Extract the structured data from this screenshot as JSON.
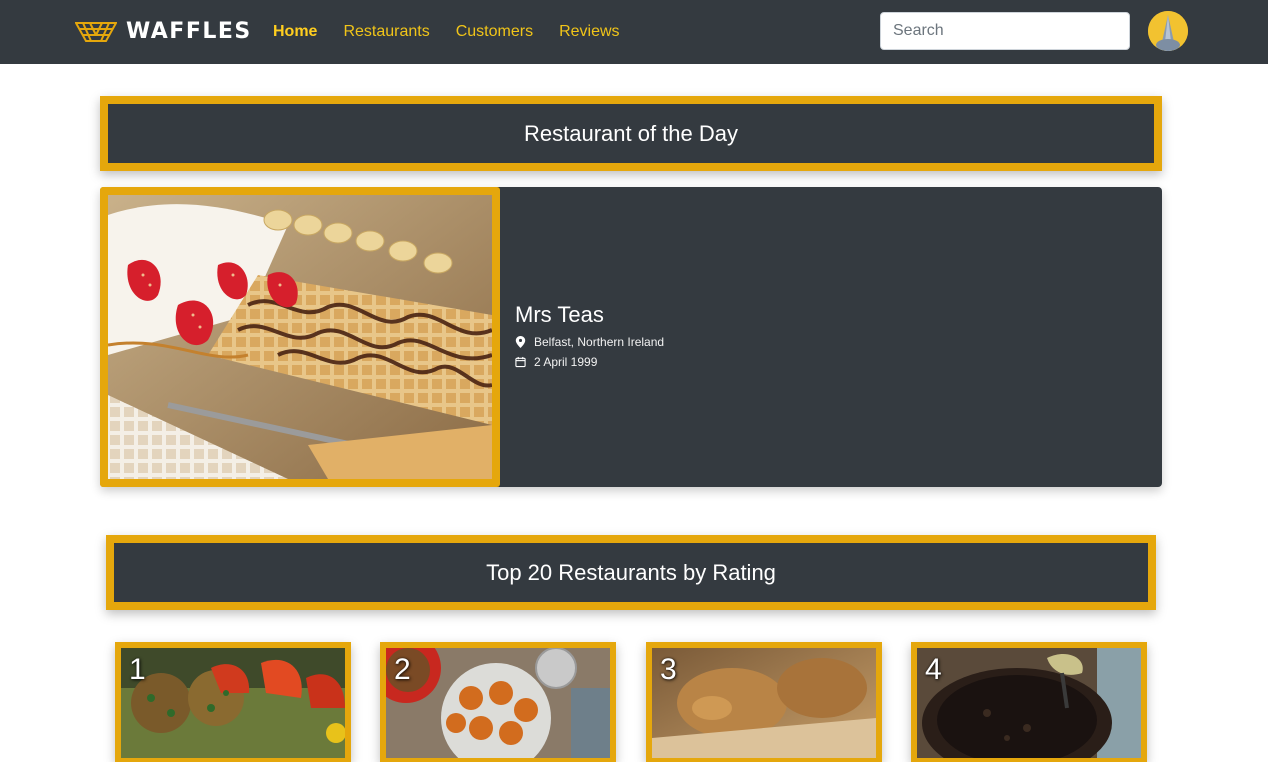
{
  "brand": {
    "name": "WAFFLES"
  },
  "nav": {
    "links": [
      {
        "label": "Home",
        "active": true
      },
      {
        "label": "Restaurants",
        "active": false
      },
      {
        "label": "Customers",
        "active": false
      },
      {
        "label": "Reviews",
        "active": false
      }
    ],
    "search_placeholder": "Search"
  },
  "restaurant_of_day": {
    "heading": "Restaurant of the Day",
    "name": "Mrs Teas",
    "location": "Belfast, Northern Ireland",
    "date": "2 April 1999"
  },
  "top_restaurants": {
    "heading": "Top 20 Restaurants by Rating",
    "ranks": [
      "1",
      "2",
      "3",
      "4"
    ]
  },
  "colors": {
    "navbar": "#343a40",
    "accent": "#e5a70c",
    "link": "#f0c419"
  }
}
